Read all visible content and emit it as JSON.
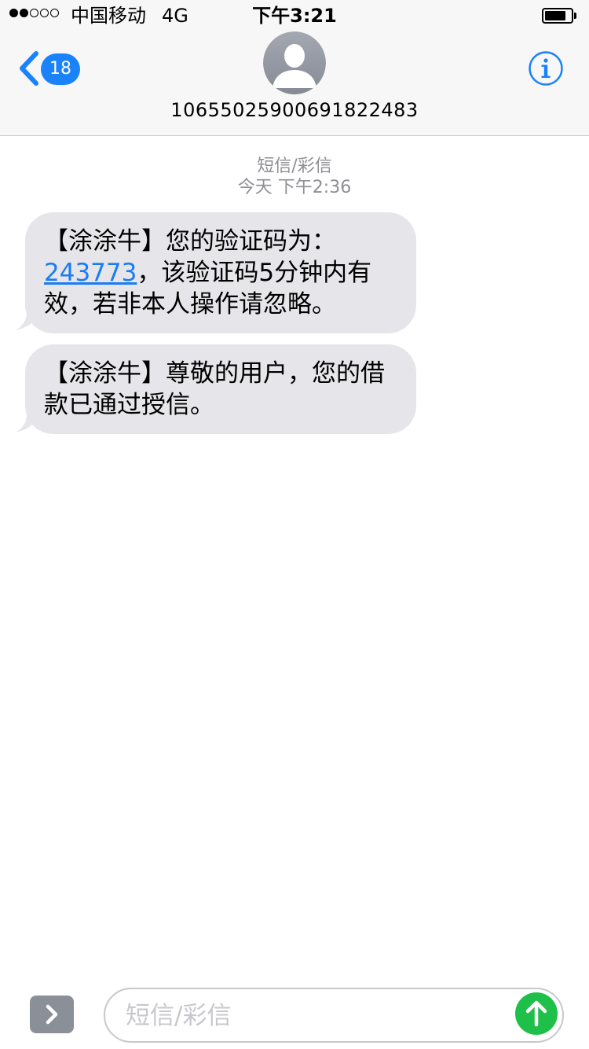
{
  "status_bar": {
    "carrier": "中国移动",
    "network": "4G",
    "time": "下午3:21",
    "signal_bars_filled": 2,
    "signal_bars_total": 5,
    "battery_level": 0.8
  },
  "header": {
    "back_badge": "18",
    "sender_number": "10655025900691822483",
    "avatar_icon": "person-silhouette-icon",
    "info_icon": "info-icon"
  },
  "conversation": {
    "service_label": "短信/彩信",
    "timestamp": "今天 下午2:36",
    "messages": [
      {
        "prefix": "【涂涂牛】您的验证码为：",
        "code": "243773",
        "suffix": "，该验证码5分钟内有效，若非本人操作请忽略。"
      },
      {
        "text": "【涂涂牛】尊敬的用户，您的借款已通过授信。"
      }
    ]
  },
  "input_bar": {
    "placeholder": "短信/彩信",
    "value": "",
    "expand_icon": "chevron-right-icon",
    "send_icon": "arrow-up-icon"
  },
  "colors": {
    "accent": "#1a82fb",
    "bubble_incoming": "#e5e5ea",
    "send_button": "#1fc04a",
    "header_background": "#f7f7f7",
    "timestamp_text": "#8e8e93"
  }
}
